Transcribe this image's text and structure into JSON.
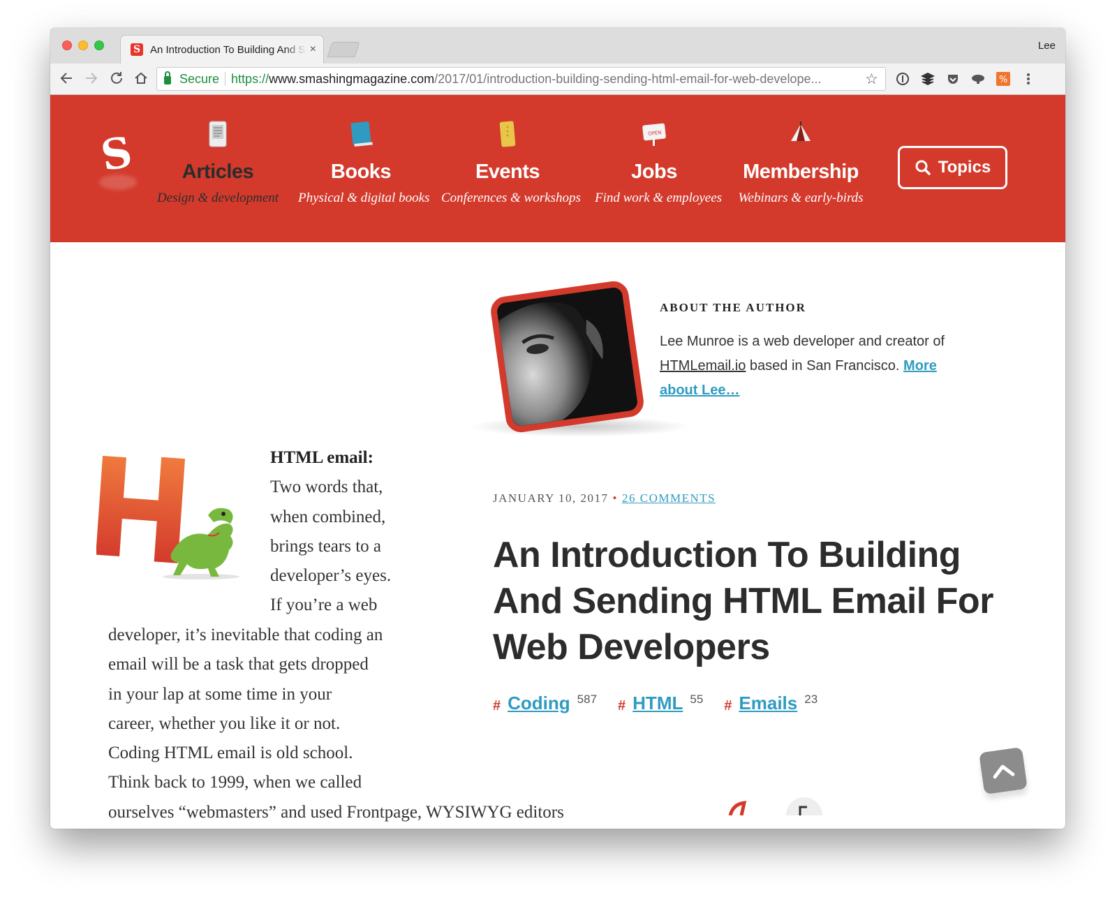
{
  "browser": {
    "tab_title": "An Introduction To Building And Sending HTML Email For Web Developers",
    "tab_close": "×",
    "profile_name": "Lee",
    "secure_label": "Secure",
    "url_scheme": "https://",
    "url_host": "www.smashingmagazine.com",
    "url_path": "/2017/01/introduction-building-sending-html-email-for-web-develope...",
    "icons": [
      "back-arrow-icon",
      "forward-arrow-icon",
      "reload-icon",
      "home-icon",
      "lock-icon",
      "bookmark-star-icon",
      "extension-icons",
      "menu-dots-icon"
    ]
  },
  "header": {
    "logo_letter": "S",
    "nav": [
      {
        "label": "Articles",
        "sub": "Design & development",
        "icon": "ebook-reader-icon"
      },
      {
        "label": "Books",
        "sub": "Physical & digital books",
        "icon": "book-icon"
      },
      {
        "label": "Events",
        "sub": "Conferences & workshops",
        "icon": "ticket-icon"
      },
      {
        "label": "Jobs",
        "sub": "Find work & employees",
        "icon": "open-sign-icon"
      },
      {
        "label": "Membership",
        "sub": "Webinars & early-birds",
        "icon": "tent-icon"
      }
    ],
    "topics_label": "Topics",
    "accent_color": "#d33a2c"
  },
  "author": {
    "heading": "ABOUT THE AUTHOR",
    "text_before": "Lee Munroe is a web developer and creator of ",
    "site": "HTMLemail.io",
    "text_after": " based in San Francisco. ",
    "more_link": "More about Lee…"
  },
  "article": {
    "date": "JANUARY 10, 2017",
    "bullet": "•",
    "comments": "26 COMMENTS",
    "title": "An Introduction To Building And Sending HTML Email For Web Developers",
    "tags": [
      {
        "hash": "#",
        "name": "Coding",
        "count": "587"
      },
      {
        "hash": "#",
        "name": "HTML",
        "count": "55"
      },
      {
        "hash": "#",
        "name": "Emails",
        "count": "23"
      }
    ],
    "lead_bold": "HTML email:",
    "lead_lines": [
      "Two words that,",
      "when combined,",
      "brings tears to a",
      "developer’s eyes.",
      "If you’re a web"
    ],
    "body_lines": [
      "developer, it’s inevitable that coding an",
      "email will be a task that gets dropped",
      "in your lap at some time in your",
      "career, whether you like it or not.",
      "Coding HTML email is old school.",
      "Think back to 1999, when we called",
      "ourselves “webmasters” and used Frontpage, WYSIWYG editors"
    ],
    "link_color": "#2f9bc1"
  }
}
